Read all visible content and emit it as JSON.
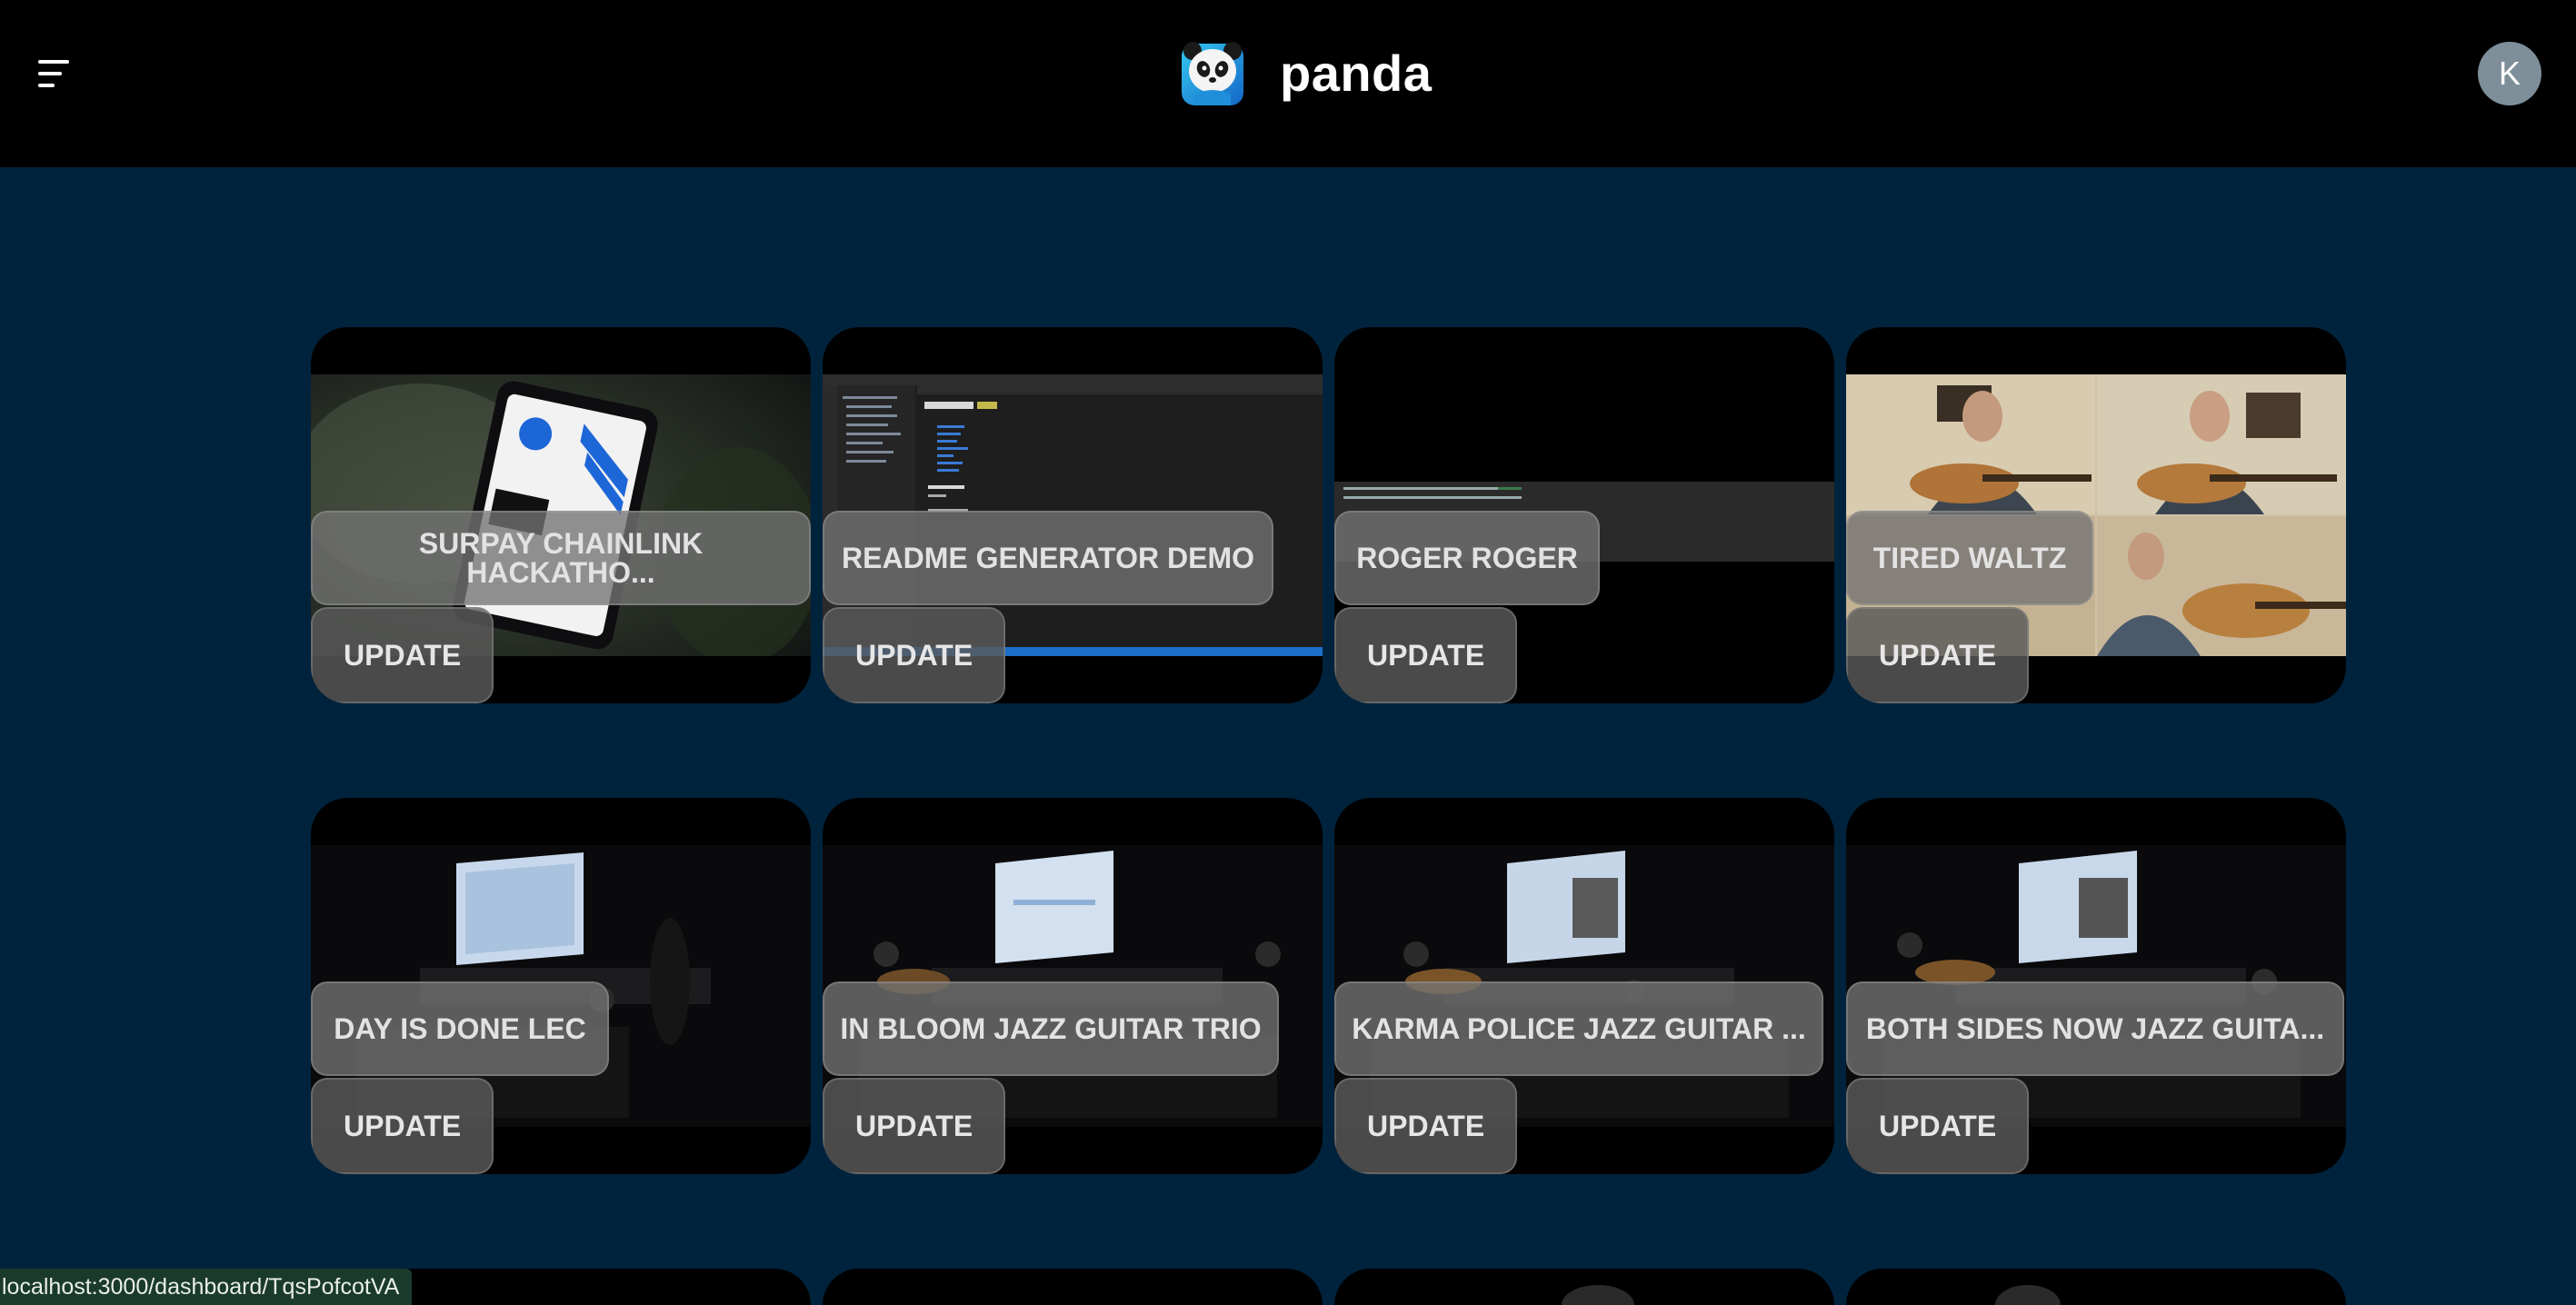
{
  "header": {
    "brand_name": "panda",
    "menu_icon": "hamburger-menu-icon",
    "logo_icon": "panda-logo-icon",
    "avatar_initial": "K"
  },
  "colors": {
    "page_background": "#00233d",
    "header_background": "#000000",
    "avatar_background": "#7e8f9a"
  },
  "cards": [
    {
      "title": "SURPAY CHAINLINK HACKATHO...",
      "button": "UPDATE"
    },
    {
      "title": "README GENERATOR DEMO",
      "button": "UPDATE"
    },
    {
      "title": "ROGER ROGER",
      "button": "UPDATE"
    },
    {
      "title": "TIRED WALTZ",
      "button": "UPDATE"
    },
    {
      "title": "DAY IS DONE LEC",
      "button": "UPDATE"
    },
    {
      "title": "IN BLOOM JAZZ GUITAR TRIO",
      "button": "UPDATE"
    },
    {
      "title": "KARMA POLICE JAZZ GUITAR ...",
      "button": "UPDATE"
    },
    {
      "title": "BOTH SIDES NOW JAZZ GUITA...",
      "button": "UPDATE"
    }
  ],
  "status_bar": {
    "url": "localhost:3000/dashboard/TqsPofcotVA"
  }
}
